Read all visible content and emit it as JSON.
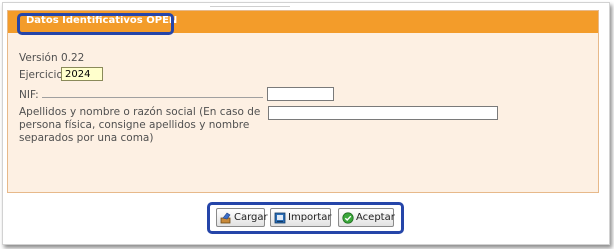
{
  "panel": {
    "title": "Datos Identificativos OPEN",
    "header_color": "#f39c2a",
    "background_color": "#fdf0e3"
  },
  "form": {
    "version_text": "Versión 0.22",
    "ejercicio_label": "Ejercicio",
    "ejercicio_value": "2024",
    "nif_label": "NIF:",
    "nif_value": "",
    "nombre_label": "Apellidos y nombre o razón social (En caso de persona física, consigne apellidos y nombre separados por una coma)",
    "nombre_value": ""
  },
  "buttons": {
    "cargar_label": "Cargar",
    "cargar_icon": "load-icon",
    "importar_label": "Importar",
    "importar_icon": "import-icon",
    "aceptar_label": "Aceptar",
    "aceptar_icon": "check-icon"
  },
  "highlight_color": "#2545a9"
}
